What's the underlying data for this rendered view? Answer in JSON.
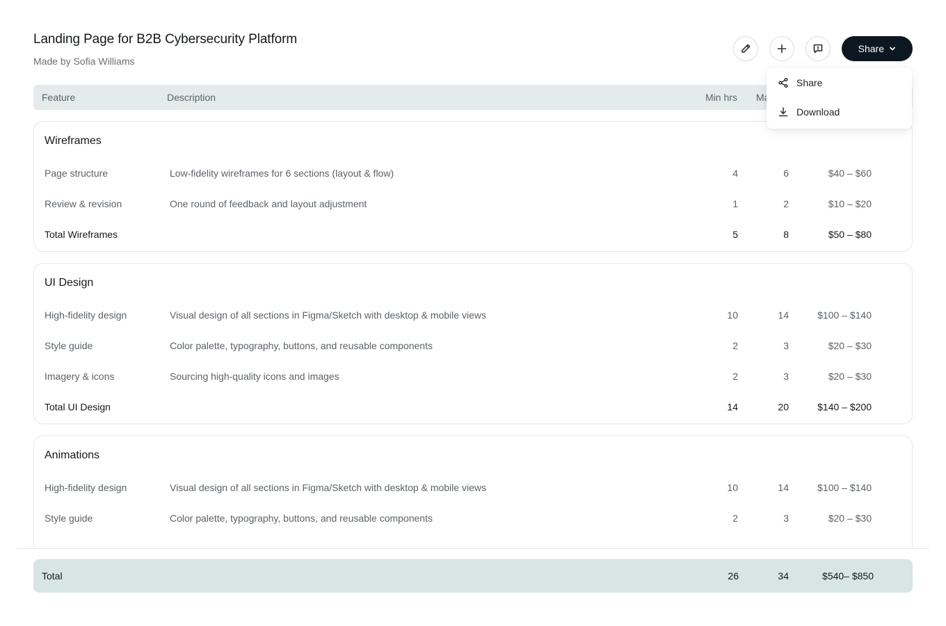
{
  "page": {
    "title": "Landing Page for B2B Cybersecurity Platform",
    "subtitle": "Made by Sofia Williams"
  },
  "toolbar": {
    "share_label": "Share",
    "icons": [
      "pencil-icon",
      "sparkle-icon",
      "comment-icon",
      "chevron-down-icon"
    ]
  },
  "dropdown": {
    "items": [
      {
        "label": "Share",
        "icon": "share-icon"
      },
      {
        "label": "Download",
        "icon": "download-icon"
      }
    ]
  },
  "table": {
    "columns": {
      "feature": "Feature",
      "description": "Description",
      "min": "Min hrs",
      "max_partial": "Ma"
    },
    "sections": [
      {
        "title": "Wireframes",
        "rows": [
          {
            "feature": "Page structure",
            "description": "Low-fidelity wireframes for 6 sections (layout & flow)",
            "min": "4",
            "max": "6",
            "price": "$40 – $60"
          },
          {
            "feature": "Review & revision",
            "description": "One round of feedback and layout adjustment",
            "min": "1",
            "max": "2",
            "price": "$10 – $20"
          }
        ],
        "total": {
          "label": "Total Wireframes",
          "min": "5",
          "max": "8",
          "price": "$50 – $80"
        }
      },
      {
        "title": "UI Design",
        "rows": [
          {
            "feature": "High-fidelity design",
            "description": "Visual design of all sections in Figma/Sketch with desktop & mobile views",
            "min": "10",
            "max": "14",
            "price": "$100 – $140"
          },
          {
            "feature": "Style guide",
            "description": "Color palette, typography, buttons, and reusable components",
            "min": "2",
            "max": "3",
            "price": "$20 – $30"
          },
          {
            "feature": "Imagery & icons",
            "description": "Sourcing high-quality icons and images",
            "min": "2",
            "max": "3",
            "price": "$20 – $30"
          }
        ],
        "total": {
          "label": "Total UI Design",
          "min": "14",
          "max": "20",
          "price": "$140 – $200"
        }
      },
      {
        "title": "Animations",
        "rows": [
          {
            "feature": "High-fidelity design",
            "description": "Visual design of all sections in Figma/Sketch with desktop & mobile views",
            "min": "10",
            "max": "14",
            "price": "$100 – $140"
          },
          {
            "feature": "Style guide",
            "description": "Color palette, typography, buttons, and reusable components",
            "min": "2",
            "max": "3",
            "price": "$20 – $30"
          }
        ]
      }
    ],
    "grand_total": {
      "label": "Total",
      "min": "26",
      "max": "34",
      "price": "$540– $850"
    }
  },
  "colors": {
    "header_bg": "#e3eceb",
    "footer_bg": "#d7e5e3",
    "primary_button": "#0d1722"
  }
}
